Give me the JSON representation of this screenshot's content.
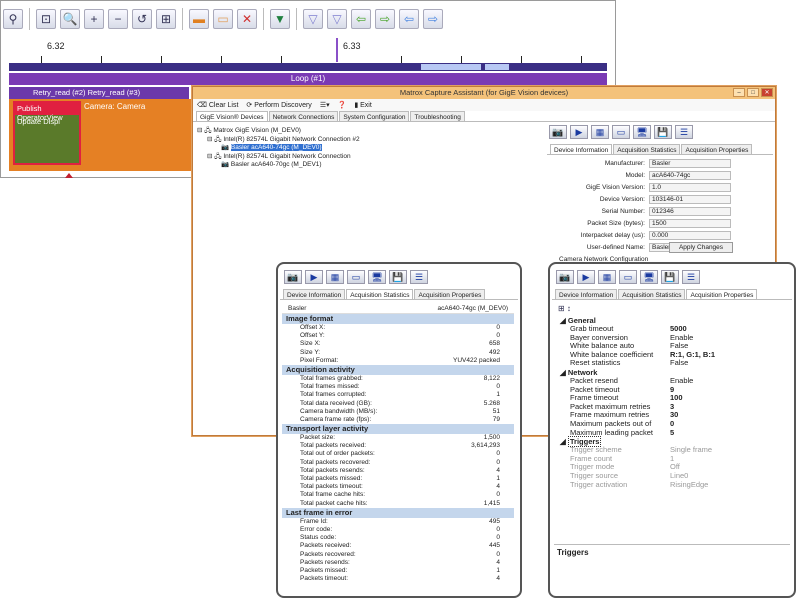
{
  "tracer": {
    "ticks": [
      "6.32",
      "6.33"
    ],
    "loop_label": "Loop (#1)",
    "retry_label": "Retry_read (#2) Retry_read (#3)",
    "publish_label": "Publish OperatorView",
    "update_label": "Update Displ",
    "camera_label": "Camera: Camera"
  },
  "main": {
    "title": "Matrox Capture Assistant (for GigE Vision devices)",
    "menu": [
      "Clear List",
      "Perform Discovery",
      "Exit"
    ],
    "tabs": [
      "GigE Vision® Devices",
      "Network Connections",
      "System Configuration",
      "Troubleshooting"
    ],
    "tree": [
      "Matrox GigE Vision (M_DEV0)",
      "Intel(R) 82574L Gigabit Network Connection #2",
      "Basler acA640-74gc (M_DEV0)",
      "Intel(R) 82574L Gigabit Network Connection",
      "Basler acA640-70gc (M_DEV1)"
    ],
    "dev_tabs": [
      "Device Information",
      "Acquisition Statistics",
      "Acquisition Properties"
    ],
    "fields": [
      {
        "label": "Manufacturer:",
        "value": "Basler"
      },
      {
        "label": "Model:",
        "value": "acA640-74gc"
      },
      {
        "label": "GigE Vision Version:",
        "value": "1.0"
      },
      {
        "label": "Device Version:",
        "value": "103146-01"
      },
      {
        "label": "Serial Number:",
        "value": "012346"
      },
      {
        "label": "Packet Size (bytes):",
        "value": "1500"
      },
      {
        "label": "Interpacket delay (us):",
        "value": "0.000"
      },
      {
        "label": "User-defined Name:",
        "value": "BaslerAce01"
      }
    ],
    "apply_label": "Apply Changes",
    "net_config_label": "Camera Network Configuration"
  },
  "stats": {
    "tabs": [
      "Device Information",
      "Acquisition Statistics",
      "Acquisition Properties"
    ],
    "device": "Basler",
    "device_model": "acA640-74gc (M_DEV0)",
    "sections": [
      {
        "title": "Image format",
        "rows": [
          [
            "Offset X:",
            "0"
          ],
          [
            "Offset Y:",
            "0"
          ],
          [
            "Size X:",
            "658"
          ],
          [
            "Size Y:",
            "492"
          ],
          [
            "Pixel Format:",
            "YUV422 packed"
          ]
        ]
      },
      {
        "title": "Acquisition activity",
        "rows": [
          [
            "Total frames grabbed:",
            "8,122"
          ],
          [
            "Total frames missed:",
            "0"
          ],
          [
            "Total frames corrupted:",
            "1"
          ],
          [
            "Total data received (GB):",
            "5.268"
          ],
          [
            "Camera bandwidth (MB/s):",
            "51"
          ],
          [
            "Camera frame rate (fps):",
            "79"
          ]
        ]
      },
      {
        "title": "Transport layer activity",
        "rows": [
          [
            "Packet size:",
            "1,500"
          ],
          [
            "Total packets received:",
            "3,614,293"
          ],
          [
            "Total out of order packets:",
            "0"
          ],
          [
            "Total packets recovered:",
            "0"
          ],
          [
            "Total packets resends:",
            "4"
          ],
          [
            "Total packets missed:",
            "1"
          ],
          [
            "Total packets timeout:",
            "4"
          ],
          [
            "Total frame cache hits:",
            "0"
          ],
          [
            "Total packet cache hits:",
            "1,415"
          ]
        ]
      },
      {
        "title": "Last frame in error",
        "rows": [
          [
            "Frame Id:",
            "495"
          ],
          [
            "Error code:",
            "0"
          ],
          [
            "Status code:",
            "0"
          ],
          [
            "Packets received:",
            "445"
          ],
          [
            "Packets recovered:",
            "0"
          ],
          [
            "Packets resends:",
            "4"
          ],
          [
            "Packets missed:",
            "1"
          ],
          [
            "Packets timeout:",
            "4"
          ]
        ]
      }
    ]
  },
  "props": {
    "tabs": [
      "Device Information",
      "Acquisition Statistics",
      "Acquisition Properties"
    ],
    "groups": [
      {
        "title": "General",
        "rows": [
          [
            "Grab timeout",
            "5000"
          ],
          [
            "Bayer conversion",
            "Enable"
          ],
          [
            "White balance auto",
            "False"
          ],
          [
            "White balance coefficient",
            "R:1, G:1, B:1"
          ],
          [
            "Reset statistics",
            "False"
          ]
        ]
      },
      {
        "title": "Network",
        "rows": [
          [
            "Packet resend",
            "Enable"
          ],
          [
            "Packet timeout",
            "9"
          ],
          [
            "Frame timeout",
            "100"
          ],
          [
            "Packet maximum retries",
            "3"
          ],
          [
            "Frame maximum retries",
            "30"
          ],
          [
            "Maximum packets out of",
            "0"
          ],
          [
            "Maximum leading packet",
            "5"
          ]
        ]
      },
      {
        "title": "Triggers",
        "dim": true,
        "rows": [
          [
            "Trigger scheme",
            "Single frame"
          ],
          [
            "Frame count",
            "1"
          ],
          [
            "Trigger mode",
            "Off"
          ],
          [
            "Trigger source",
            "Line0"
          ],
          [
            "Trigger activation",
            "RisingEdge"
          ]
        ]
      }
    ],
    "footer_label": "Triggers"
  }
}
